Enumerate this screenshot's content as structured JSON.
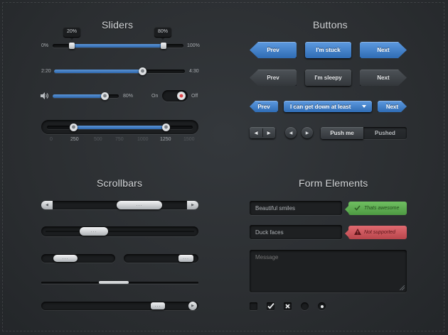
{
  "sections": {
    "sliders": "Sliders",
    "buttons": "Buttons",
    "scrollbars": "Scrollbars",
    "form": "Form Elements"
  },
  "sliders": {
    "range": {
      "min_label": "0%",
      "max_label": "100%",
      "low_tip": "20%",
      "high_tip": "80%",
      "low_value": 20,
      "high_value": 80
    },
    "time": {
      "start": "2:20",
      "end": "4:30",
      "progress_percent": 67
    },
    "volume": {
      "value_label": "80%",
      "value_percent": 80
    },
    "toggle": {
      "on_label": "On",
      "off_label": "Off",
      "state": "off"
    },
    "big_range": {
      "ticks": [
        "0",
        "250",
        "500",
        "750",
        "1000",
        "1250",
        "1500"
      ],
      "low": 250,
      "high": 1250,
      "max": 1500
    }
  },
  "buttons": {
    "row1": {
      "prev": "Prev",
      "middle": "I'm stuck",
      "next": "Next"
    },
    "row2": {
      "prev": "Prev",
      "middle": "I'm sleepy",
      "next": "Next"
    },
    "row3": {
      "prev": "Prev",
      "dropdown": "I can get down at least",
      "next": "Next"
    },
    "row4": {
      "push": "Push me",
      "pushed": "Pushed"
    }
  },
  "scrollbars": {
    "thumb_glyph": "..."
  },
  "form": {
    "input1": "Beautiful smiles",
    "input2": "Duck faces",
    "message_placeholder": "Message",
    "success_text": "Thats awesome",
    "error_text": "Not supported",
    "icons": {
      "success": "check-icon",
      "error": "warning-icon"
    },
    "colors": {
      "success": "#5daf51",
      "error": "#cc575d",
      "accent": "#3a78c2"
    }
  }
}
